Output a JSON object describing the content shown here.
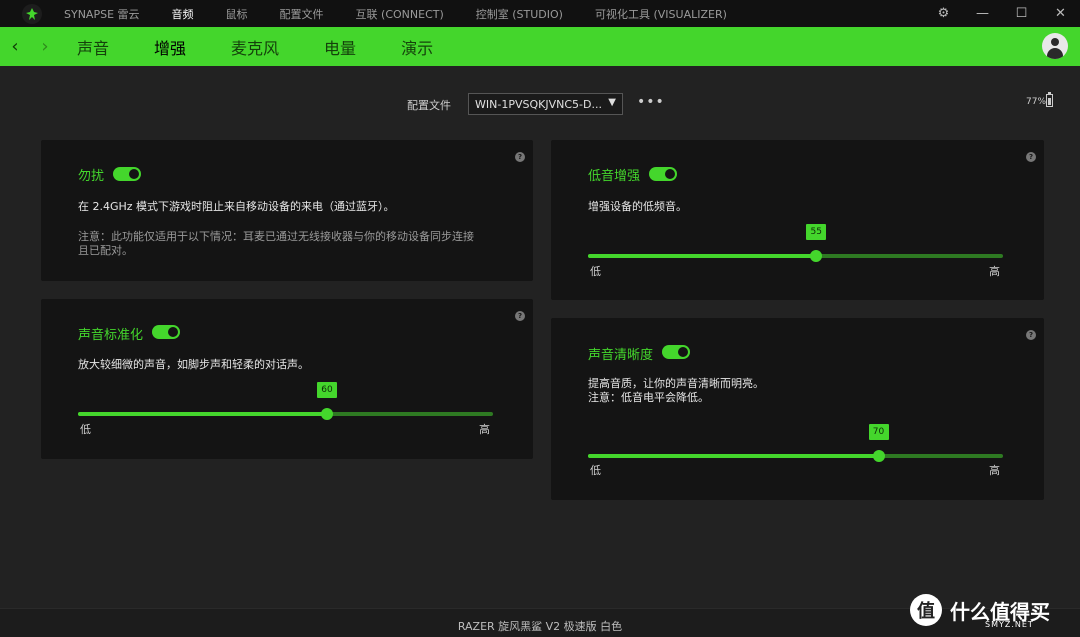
{
  "titlebar": {
    "nav": [
      {
        "label": "SYNAPSE 雷云",
        "active": false
      },
      {
        "label": "音频",
        "active": true
      },
      {
        "label": "鼠标",
        "active": false
      },
      {
        "label": "配置文件",
        "active": false
      },
      {
        "label": "互联 (CONNECT)",
        "active": false
      },
      {
        "label": "控制室 (STUDIO)",
        "active": false
      },
      {
        "label": "可视化工具 (VISUALIZER)",
        "active": false
      }
    ],
    "controls": {
      "settings": "⚙",
      "minimize": "—",
      "maximize": "☐",
      "close": "✕"
    }
  },
  "subnav": {
    "back": "‹",
    "forward": "›",
    "tabs": [
      "声音",
      "增强",
      "麦克风",
      "电量",
      "演示"
    ],
    "active_tab": "增强"
  },
  "profile": {
    "label": "配置文件",
    "selected": "WIN-1PVSQKJVNC5-D...",
    "more": "•••",
    "battery_text": "77%",
    "battery_level": 77
  },
  "cards": {
    "dnd": {
      "title": "勿扰",
      "enabled": true,
      "help": "?",
      "description": "在 2.4GHz 模式下游戏时阻止来自移动设备的来电（通过蓝牙）。",
      "note_line1": "注意：此功能仅适用于以下情况：耳麦已通过无线接收器与你的移动设备同步连接",
      "note_line2": "且已配对。"
    },
    "normalization": {
      "title": "声音标准化",
      "enabled": true,
      "help": "?",
      "description": "放大较细微的声音，如脚步声和轻柔的对话声。",
      "value": 60,
      "value_label": "60",
      "min_label": "低",
      "max_label": "高"
    },
    "bass": {
      "title": "低音增强",
      "enabled": true,
      "help": "?",
      "description": "增强设备的低频音。",
      "value": 55,
      "value_label": "55",
      "min_label": "低",
      "max_label": "高"
    },
    "clarity": {
      "title": "声音清晰度",
      "enabled": true,
      "help": "?",
      "description_line1": "提高音质，让你的声音清晰而明亮。",
      "description_line2": "注意：低音电平会降低。",
      "value": 70,
      "value_label": "70",
      "min_label": "低",
      "max_label": "高"
    }
  },
  "footer": {
    "device": "RAZER 旋风黑鲨 V2 极速版 白色"
  },
  "watermark": {
    "badge": "值",
    "text": "什么值得买",
    "sub": "SMYZ.NET"
  },
  "colors": {
    "accent": "#44d62c",
    "background": "#222222",
    "card": "#141414"
  }
}
